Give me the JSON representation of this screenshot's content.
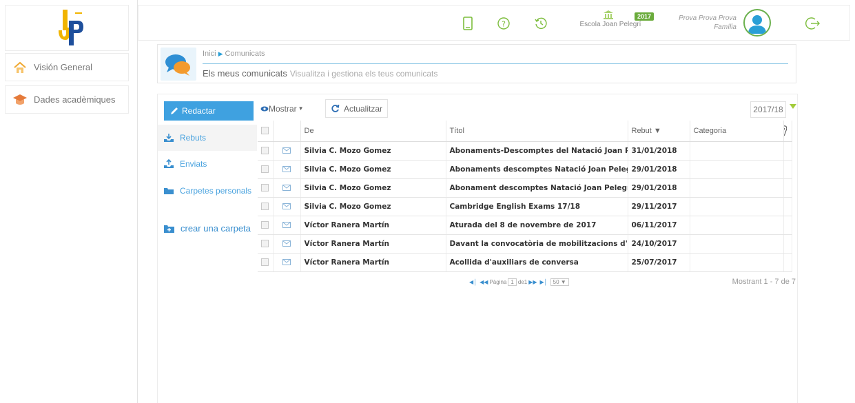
{
  "logo": {
    "text": "Joan Pelegrí"
  },
  "sidebar": {
    "items": [
      {
        "label": "Visión General",
        "icon": "home-icon"
      },
      {
        "label": "Dades acadèmiques",
        "icon": "graduation-cap-icon"
      }
    ]
  },
  "header": {
    "school_name": "Escola Joan Pelegrí",
    "year_badge": "2017",
    "user_name": "Prova Prova Prova",
    "user_role": "Família",
    "icons": [
      "tablet-icon",
      "help-icon",
      "history-icon",
      "school-icon",
      "avatar-icon",
      "logout-icon"
    ]
  },
  "breadcrumb": {
    "home": "Inici",
    "current": "Comunicats",
    "title": "Els meus comunicats",
    "subtitle": "Visualitza i gestiona els teus comunicats"
  },
  "folders": {
    "compose": "Redactar",
    "received": "Rebuts",
    "sent": "Enviats",
    "personal": "Carpetes personals",
    "create": "crear una carpeta"
  },
  "toolbar": {
    "show": "Mostrar",
    "refresh": "Actualitzar",
    "year": "2017/18"
  },
  "table": {
    "headers": {
      "from": "De",
      "title": "Títol",
      "received": "Rebut ▼",
      "category": "Categoria"
    },
    "rows": [
      {
        "from": "Silvia C. Mozo Gomez",
        "title": "Abonaments-Descomptes del Natació Joan P",
        "date": "31/01/2018",
        "category": ""
      },
      {
        "from": "Silvia C. Mozo Gomez",
        "title": "Abonaments descomptes Natació Joan Peleg",
        "date": "29/01/2018",
        "category": ""
      },
      {
        "from": "Silvia C. Mozo Gomez",
        "title": "Abonament descomptes Natació Joan Pelegr",
        "date": "29/01/2018",
        "category": ""
      },
      {
        "from": "Silvia C. Mozo Gomez",
        "title": "Cambridge English Exams 17/18",
        "date": "29/11/2017",
        "category": ""
      },
      {
        "from": "Víctor Ranera Martín",
        "title": "Aturada del 8 de novembre de 2017",
        "date": "06/11/2017",
        "category": ""
      },
      {
        "from": "Víctor Ranera Martín",
        "title": "Davant la convocatòria de mobilitzacions d'(",
        "date": "24/10/2017",
        "category": ""
      },
      {
        "from": "Víctor Ranera Martín",
        "title": "Acollida d'auxiliars de conversa",
        "date": "25/07/2017",
        "category": ""
      }
    ]
  },
  "pager": {
    "page_label": "Pàgina",
    "page": "1",
    "of_label": "de",
    "total_pages": "1",
    "page_size": "50",
    "count": "Mostrant 1 - 7 de 7"
  },
  "colors": {
    "accent": "#3fa1e0",
    "badge": "#6aab3b",
    "arrow": "#a3cc3b"
  }
}
